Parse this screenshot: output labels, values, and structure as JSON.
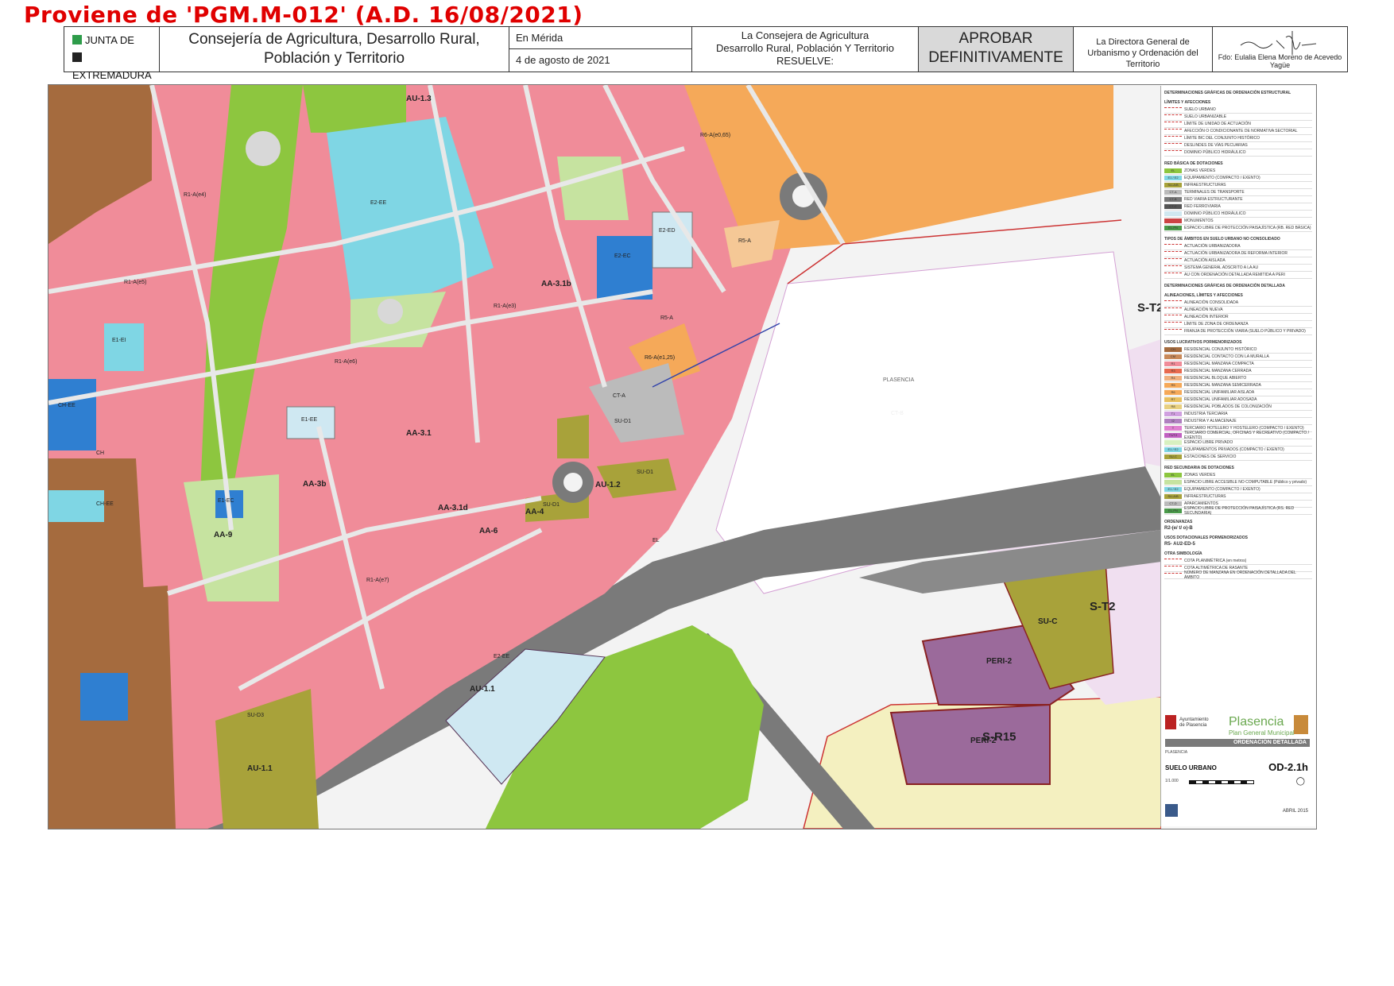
{
  "provenance": "Proviene de 'PGM.M-012' (A.D. 16/08/2021)",
  "header": {
    "junta_line1": "JUNTA DE",
    "junta_line2": "EXTREMADURA",
    "consejeria_line1": "Consejería de Agricultura, Desarrollo Rural,",
    "consejeria_line2": "Población y Territorio",
    "place": "En Mérida",
    "date": "4 de agosto de 2021",
    "resuelve_line1": "La Consejera de Agricultura",
    "resuelve_line2": "Desarrollo Rural, Población Y Territorio",
    "resuelve_line3": "RESUELVE:",
    "aprobar_line1": "APROBAR",
    "aprobar_line2": "DEFINITIVAMENTE",
    "directora_line1": "La Directora General de",
    "directora_line2": "Urbanismo y Ordenación del Territorio",
    "firma": "Fdo: Eulalia Elena Moreno de Acevedo Yagüe",
    "colors": {
      "junta_green": "#2e9c4a",
      "junta_black": "#222222",
      "aprobar_bg": "#d9d9d9"
    }
  },
  "map": {
    "colors": {
      "residential": "#f08c99",
      "green_zone": "#8dc63f",
      "light_green": "#c6e3a0",
      "equipment": "#7fd6e4",
      "blue_equipment": "#2f7fd1",
      "orange_block": "#f5a959",
      "brown_block": "#a56b3e",
      "olive_block": "#a8a23a",
      "peri": "#9b6a9b",
      "sr15": "#f4f0c0",
      "st2": "#f0dff0",
      "road": "#7a7a7a",
      "light_road": "#d8d8d8"
    },
    "labels": {
      "st2_top": "S-T2",
      "st2_mid": "S-T2",
      "sr15": "S-R15",
      "peri2_a": "PERI-2",
      "peri2_b": "PERI-2",
      "au11_a": "AU-1.1",
      "au11_b": "AU-1.1",
      "au13": "AU-1.3",
      "au12": "AU-1.2",
      "aa31b": "AA-3.1b",
      "aa31": "AA-3.1",
      "aa31d": "AA-3.1d",
      "aa3b": "AA-3b",
      "aa4": "AA-4",
      "aa6": "AA-6",
      "aa9": "AA-9",
      "sud1_a": "SU-D1",
      "sud1_b": "SU-D1",
      "sud1_c": "SU-D1",
      "suc": "SU-C",
      "sud3": "SU-D3",
      "e2ee": "E2-EE",
      "e2ee_b": "E2-EE",
      "e2ec": "E2-EC",
      "e2ed": "E2-ED",
      "e1ee": "E1-EE",
      "e1ec": "E1-EC",
      "e1ei": "E1-EI",
      "chee": "CH-EE",
      "chee_b": "CH-EE",
      "ch": "CH",
      "r5a": "R5-A",
      "r5a_b": "R5-A",
      "r6a_1": "R6-A(e0,65)",
      "r6a_2": "R6-A(e1,25)",
      "r1a_1": "R1-A(e4)",
      "r1a_2": "R1-A(e5)",
      "r1a_3": "R1-A(e3)",
      "r1a_4": "R1-A(e6)",
      "r1a_5": "R1-A(e7)",
      "ctb": "CT-B",
      "el": "EL",
      "ct_a": "CT-A",
      "plasencia_river": "PLASENCIA"
    }
  },
  "legend": {
    "title1": "DETERMINACIONES GRÁFICAS DE ORDENACIÓN ESTRUCTURAL",
    "sec_limits": "LÍMITES Y AFECCIONES",
    "limits": [
      "SUELO URBANO",
      "SUELO URBANIZABLE",
      "LÍMITE DE UNIDAD DE ACTUACIÓN",
      "AFECCIÓN O CONDICIONANTE DE NORMATIVA SECTORIAL",
      "LÍMITE BIC DEL CONJUNTO HISTÓRICO",
      "DESLINDES DE VÍAS PECUARIAS",
      "DOMINIO PÚBLICO HIDRÁULICO"
    ],
    "sec_red": "RED BÁSICA DE DOTACIONES",
    "red": [
      {
        "code": "EL",
        "label": "ZONAS VERDES",
        "color": "#8dc63f"
      },
      {
        "code": "E1 / E2",
        "label": "EQUIPAMIENTO (COMPACTO / EXENTO)",
        "color": "#7fd6e4"
      },
      {
        "code": "SU-A/B",
        "label": "INFRAESTRUCTURAS",
        "color": "#a8a23a"
      },
      {
        "code": "CT-A",
        "label": "TERMINALES DE TRANSPORTE",
        "color": "#bbbbbb"
      },
      {
        "code": "CT-B",
        "label": "RED VIARIA ESTRUCTURANTE",
        "color": "#7a7a7a"
      },
      {
        "code": "CT-C",
        "label": "RED FERROVIARIA",
        "color": "#555555"
      },
      {
        "code": "",
        "label": "DOMINIO PÚBLICO HIDRÁULICO",
        "color": "#d0e8f0"
      },
      {
        "code": "",
        "label": "MONUMENTOS",
        "color": "#cc4444"
      },
      {
        "code": "EL-PN",
        "label": "ESPACIO LIBRE DE PROTECCIÓN PAISAJÍSTICA (RB. RED BÁSICA)",
        "color": "#4a9a4a"
      }
    ],
    "sec_tipos": "TIPOS DE ÁMBITOS EN SUELO URBANO NO CONSOLIDADO",
    "tipos": [
      "ACTUACIÓN URBANIZADORA",
      "ACTUACIÓN URBANIZADORA DE REFORMA INTERIOR",
      "ACTUACIÓN AISLADA",
      "SISTEMA GENERAL ADSCRITO A LA AU",
      "AU CON ORDENACIÓN DETALLADA REMITIDA A PERI"
    ],
    "title2": "DETERMINACIONES GRÁFICAS DE ORDENACIÓN DETALLADA",
    "sec_alineaciones": "ALINEACIONES, LÍMITES Y AFECCIONES",
    "alineaciones": [
      "ALINEACIÓN CONSOLIDADA",
      "ALINEACIÓN NUEVA",
      "ALINEACIÓN INTERIOR",
      "LÍMITE DE ZONA DE ORDENANZA",
      "FRANJA DE PROTECCIÓN VIARIA (SUELO PÚBLICO Y PRIVADO)"
    ],
    "sec_usos": "USOS LUCRATIVOS PORMENORIZADOS",
    "usos": [
      {
        "code": "CH",
        "label": "RESIDENCIAL CONJUNTO HISTÓRICO",
        "color": "#a56b3e"
      },
      {
        "code": "CM",
        "label": "RESIDENCIAL CONTACTO CON LA MURALLA",
        "color": "#c98a5a"
      },
      {
        "code": "R1",
        "label": "RESIDENCIAL MANZANA COMPACTA",
        "color": "#f08c99"
      },
      {
        "code": "R3",
        "label": "RESIDENCIAL MANZANA CERRADA",
        "color": "#e86a50"
      },
      {
        "code": "R4",
        "label": "RESIDENCIAL BLOQUE ABIERTO",
        "color": "#f0b080"
      },
      {
        "code": "R5",
        "label": "RESIDENCIAL MANZANA SEMICERRADA",
        "color": "#f5a959"
      },
      {
        "code": "R6",
        "label": "RESIDENCIAL UNIFAMILIAR AISLADA",
        "color": "#f5a959"
      },
      {
        "code": "R7",
        "label": "RESIDENCIAL UNIFAMILIAR ADOSADA",
        "color": "#e8c060"
      },
      {
        "code": "R8",
        "label": "RESIDENCIAL POBLADOS DE COLONIZACIÓN",
        "color": "#e8d080"
      },
      {
        "code": "T1",
        "label": "INDUSTRIA TERCIARIA",
        "color": "#d0a0e0"
      },
      {
        "code": "I2",
        "label": "INDUSTRIA Y ALMACENAJE",
        "color": "#b080c0"
      },
      {
        "code": "T",
        "label": "TERCIARIO HOTELERO Y HOSTELERO (COMPACTO / EXENTO)",
        "color": "#e080d0"
      },
      {
        "code": "T1/T2",
        "label": "TERCIARIO COMERCIAL, OFICINAS Y RECREATIVO (COMPACTO / EXENTO)",
        "color": "#c060c0"
      },
      {
        "code": "",
        "label": "ESPACIO LIBRE PRIVADO",
        "color": "#d8f0c0"
      },
      {
        "code": "E1 / E2",
        "label": "EQUIPAMIENTOS PRIVADOS (COMPACTO / EXENTO)",
        "color": "#7fd6e4"
      },
      {
        "code": "SU-C",
        "label": "ESTACIONES DE SERVICIO",
        "color": "#a8a23a"
      }
    ],
    "sec_red2": "RED SECUNDARIA DE DOTACIONES",
    "red2": [
      {
        "code": "EL",
        "label": "ZONAS VERDES",
        "color": "#8dc63f"
      },
      {
        "code": "",
        "label": "ESPACIO LIBRE ACCESIBLE NO COMPUTABLE (Público y privado)",
        "color": "#c6e3a0"
      },
      {
        "code": "E1 / E2",
        "label": "EQUIPAMIENTO (COMPACTO / EXENTO)",
        "color": "#7fd6e4"
      },
      {
        "code": "SU-A/B",
        "label": "INFRAESTRUCTURAS",
        "color": "#a8a23a"
      },
      {
        "code": "CT-D",
        "label": "APARCAMIENTOS",
        "color": "#bbbbbb"
      },
      {
        "code": "EL-PN",
        "label": "ESPACIO LIBRE DE PROTECCIÓN PAISAJÍSTICA (RS. RED SECUNDARIA)",
        "color": "#4a9a4a"
      }
    ],
    "sec_ordenanzas": "ORDENANZAS",
    "ordenanza_example": "R2-(e/ t/ o)-B",
    "sec_dotacionales": "USOS DOTACIONALES PORMENORIZADOS",
    "dotacional_example": "R5- AU2-ED-5",
    "sec_otra": "OTRA SIMBOLOGÍA",
    "otra": [
      "COTA PLANIMÉTRICA (en metros)",
      "COTA ALTIMÉTRICA DE RASANTE",
      "NÚMERO DE MANZANA EN ORDENACIÓN DETALLADA DEL ÁMBITO"
    ]
  },
  "titleblock": {
    "municipality_small": "Ayuntamiento de Plasencia",
    "brand": "Plasencia",
    "subtitle": "Plan General Municipal",
    "band": "ORDENACIÓN DETALLADA",
    "place": "PLASENCIA",
    "suelo": "SUELO URBANO",
    "sheet": "OD-2.1h",
    "scale": "1/1.000",
    "date": "ABRIL 2015",
    "brand_color": "#6aa84f",
    "band_color": "#7a7a7a"
  }
}
